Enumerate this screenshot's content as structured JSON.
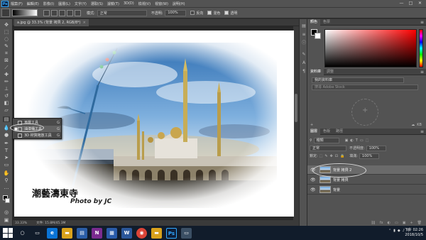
{
  "app": {
    "logo": "Ps"
  },
  "menu": [
    "檔案(F)",
    "編輯(E)",
    "影像(I)",
    "圖層(L)",
    "文字(Y)",
    "選取(S)",
    "濾鏡(T)",
    "3D(D)",
    "檢視(V)",
    "視窗(W)",
    "說明(H)"
  ],
  "window_controls": [
    "—",
    "□",
    "✕"
  ],
  "options": {
    "mode_label": "模式:",
    "mode_value": "正常",
    "opacity_label": "不透明:",
    "opacity_value": "100%",
    "reverse_label": "反向",
    "dither_label": "混色",
    "transparency_label": "透明"
  },
  "document": {
    "tab_title": "a.jpg @ 33.3% (背景 拷貝 2, RGB/8*)",
    "tab_close": "×",
    "watermark_title": "潮藝濤東寺",
    "watermark_credit": "Photo by JC"
  },
  "status": {
    "zoom": "33.33%",
    "doc_size": "文件: 15.8M/45.3M"
  },
  "flyout": {
    "items": [
      {
        "label": "漸層工具",
        "key": "G",
        "bullet": ""
      },
      {
        "label": "油漆桶工具",
        "key": "G",
        "bullet": "■"
      },
      {
        "label": "3D 材質拖放工具",
        "key": "G",
        "bullet": ""
      }
    ]
  },
  "panels": {
    "color_tabs": [
      "顏色",
      "色票"
    ],
    "library_tabs": [
      "資料庫",
      "調整"
    ],
    "library_select": "我的資料庫",
    "library_search": "搜尋 Adobe Stock",
    "library_size": "KB",
    "layers_tabs": [
      "圖層",
      "色版",
      "路徑"
    ],
    "kind_label": "種類",
    "blend_mode": "正常",
    "opacity_label": "不透明度:",
    "opacity_value": "100%",
    "lock_label": "鎖定:",
    "fill_label": "填滿:",
    "fill_value": "100%",
    "footer_icons": [
      "fx",
      "◐",
      "▭",
      "▣",
      "🗑"
    ]
  },
  "layers": [
    {
      "name": "背景 拷貝 2",
      "visible": true,
      "selected": true
    },
    {
      "name": "背景 拷貝",
      "visible": true,
      "selected": false
    },
    {
      "name": "背景",
      "visible": true,
      "selected": false
    }
  ],
  "taskbar": {
    "apps": [
      {
        "name": "search",
        "label": "○",
        "color": "#111c2b"
      },
      {
        "name": "task-view",
        "label": "▭",
        "color": "#111c2b"
      },
      {
        "name": "edge",
        "label": "e",
        "color": "#0a74d6"
      },
      {
        "name": "explorer",
        "label": "▬",
        "color": "#d9a21c"
      },
      {
        "name": "store",
        "label": "▤",
        "color": "#2b5ea8"
      },
      {
        "name": "onenote",
        "label": "N",
        "color": "#7a2b8f"
      },
      {
        "name": "calendar",
        "label": "▦",
        "color": "#2a5caa"
      },
      {
        "name": "word",
        "label": "W",
        "color": "#2b579a"
      },
      {
        "name": "chrome",
        "label": "◉",
        "color": "#db4437"
      },
      {
        "name": "folder",
        "label": "▬",
        "color": "#d9a21c"
      },
      {
        "name": "photoshop",
        "label": "Ps",
        "color": "#0e1f3a"
      },
      {
        "name": "app-2",
        "label": "▭",
        "color": "#3b4f64"
      }
    ],
    "tray_icons": [
      "⌃",
      "▮",
      "◆",
      "♪",
      "中"
    ],
    "time": "下午 02:26",
    "date": "2018/10/5"
  },
  "colors": {
    "accent": "#31a8ff",
    "panel": "#535353",
    "dark": "#323232"
  }
}
